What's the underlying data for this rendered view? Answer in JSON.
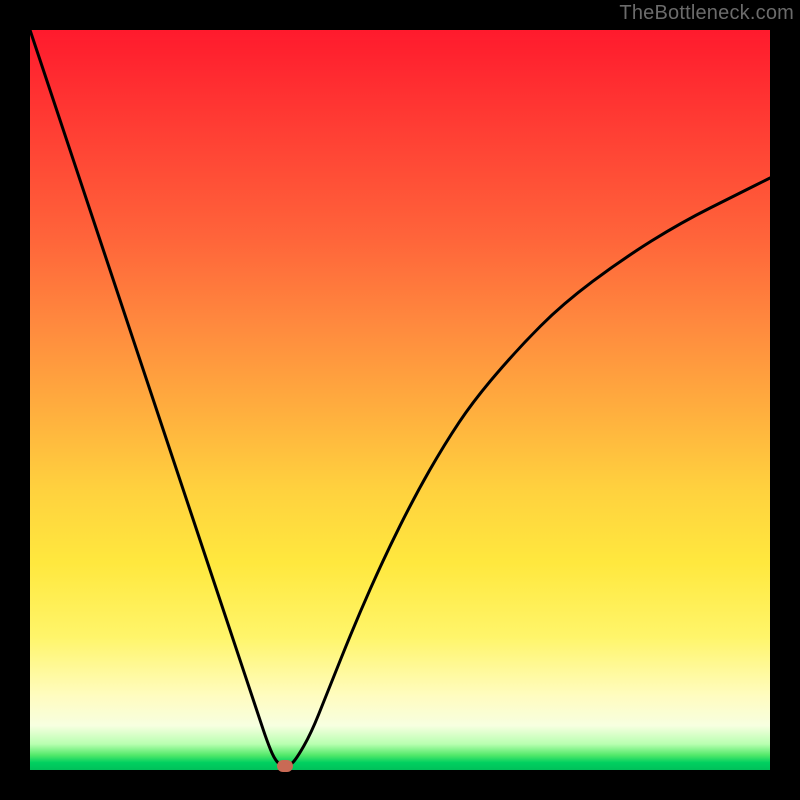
{
  "attribution": "TheBottleneck.com",
  "colors": {
    "frame": "#000000",
    "curve": "#000000",
    "marker": "#c96a55"
  },
  "chart_data": {
    "type": "line",
    "title": "",
    "xlabel": "",
    "ylabel": "",
    "xlim": [
      0,
      100
    ],
    "ylim": [
      0,
      100
    ],
    "series": [
      {
        "name": "bottleneck-curve",
        "x": [
          0,
          4,
          8,
          12,
          16,
          20,
          24,
          26,
          28,
          30,
          31,
          32,
          33,
          34,
          35,
          36,
          38,
          40,
          44,
          48,
          52,
          56,
          60,
          66,
          72,
          80,
          88,
          96,
          100
        ],
        "values": [
          100,
          88,
          76,
          64,
          52,
          40,
          28,
          22,
          16,
          10,
          7,
          4,
          1.5,
          0.5,
          0.5,
          1.5,
          5,
          10,
          20,
          29,
          37,
          44,
          50,
          57,
          63,
          69,
          74,
          78,
          80
        ]
      }
    ],
    "marker": {
      "x": 34.5,
      "y": 0.5
    },
    "grid": false,
    "background_gradient": {
      "direction": "vertical",
      "stops": [
        {
          "pos": 0.0,
          "color": "#ff1a2d"
        },
        {
          "pos": 0.28,
          "color": "#ff643a"
        },
        {
          "pos": 0.52,
          "color": "#ffb03e"
        },
        {
          "pos": 0.72,
          "color": "#ffe83e"
        },
        {
          "pos": 0.9,
          "color": "#fffcc0"
        },
        {
          "pos": 0.98,
          "color": "#52e86a"
        },
        {
          "pos": 1.0,
          "color": "#00c05a"
        }
      ]
    }
  }
}
